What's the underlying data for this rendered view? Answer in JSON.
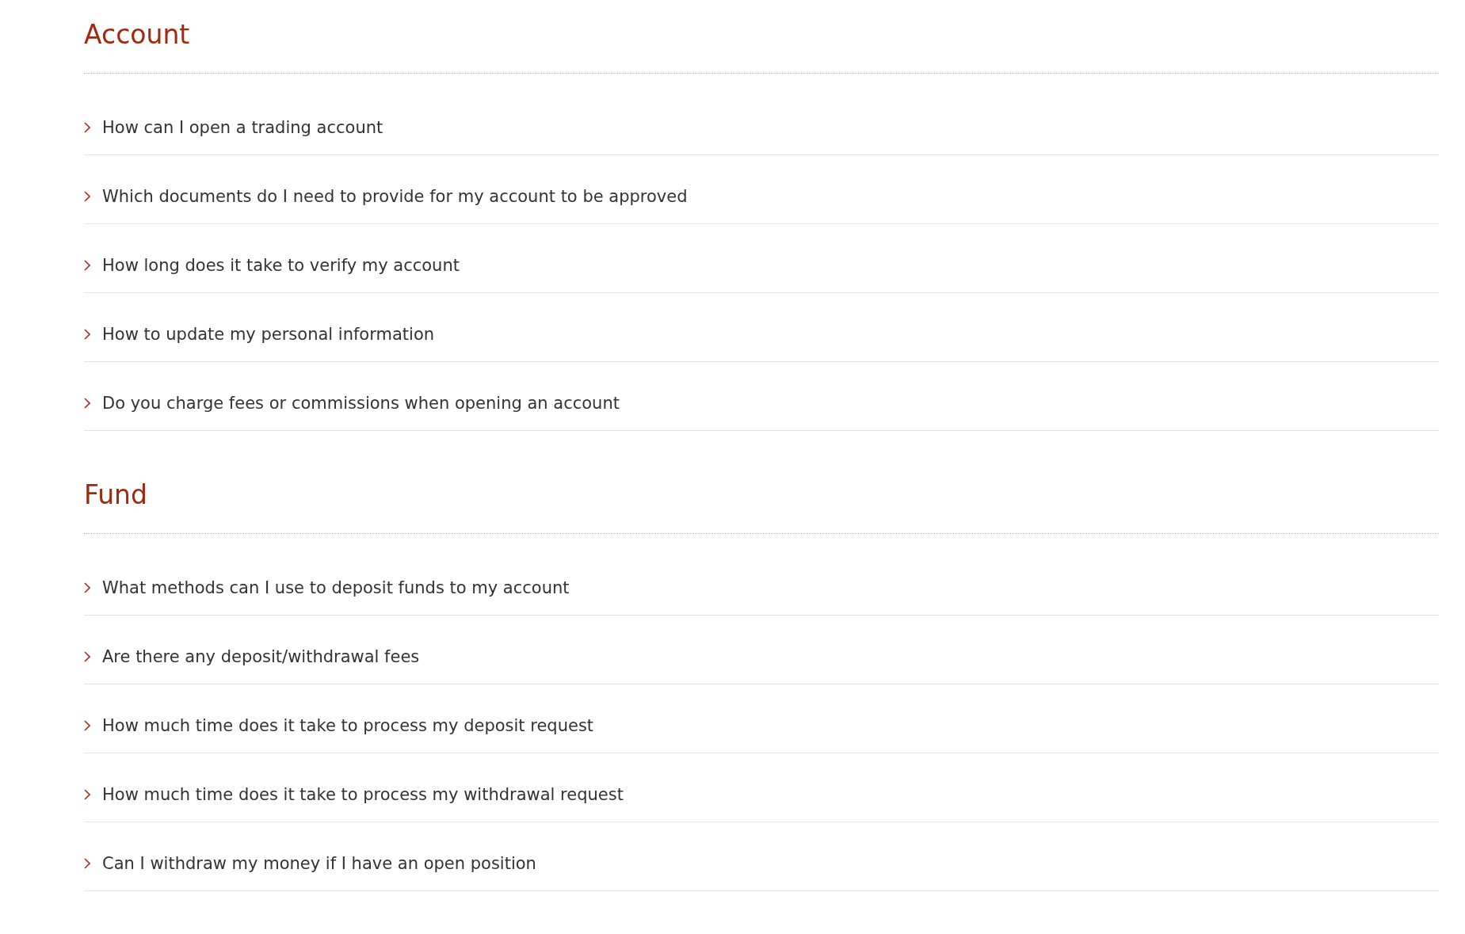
{
  "sections": [
    {
      "title": "Account",
      "questions": [
        "How can I open a trading account",
        "Which documents do I need to provide for my account to be approved",
        "How long does it take to verify my account",
        "How to update my personal information",
        "Do you charge fees or commissions when opening an account"
      ]
    },
    {
      "title": "Fund",
      "questions": [
        "What methods can I use to deposit funds to my account",
        "Are there any deposit/withdrawal fees",
        "How much time does it take to process my deposit request",
        "How much time does it take to process my withdrawal request",
        "Can I withdraw my money if I have an open position"
      ]
    }
  ]
}
